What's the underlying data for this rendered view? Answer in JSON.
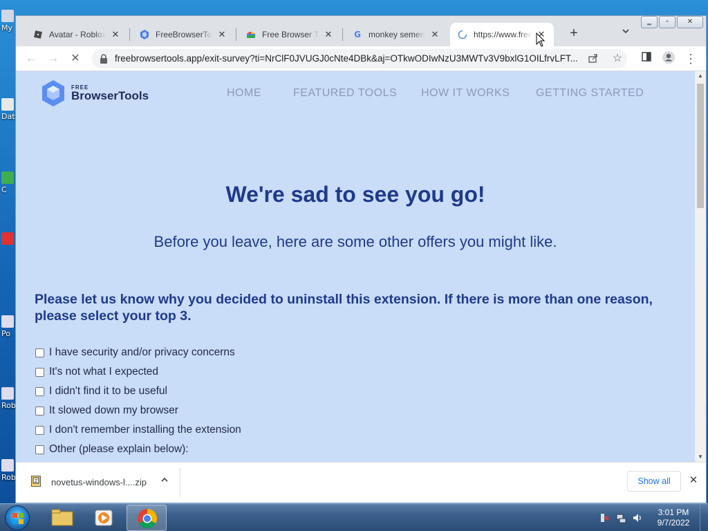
{
  "browser": {
    "tabs": [
      {
        "title": "Avatar - Roblox",
        "favicon": "roblox-icon",
        "active": false
      },
      {
        "title": "FreeBrowserTools",
        "favicon": "freebrowsertools-icon",
        "active": false
      },
      {
        "title": "Free Browser Tools",
        "favicon": "chrome-webstore-icon",
        "active": false
      },
      {
        "title": "monkey semen -",
        "favicon": "google-icon",
        "active": false
      },
      {
        "title": "https://www.free",
        "favicon": "loading-spinner-icon",
        "active": true
      }
    ],
    "new_tab_label": "+",
    "toolbar": {
      "url": "freebrowsertools.app/exit-survey?ti=NrClF0JVUGJ0cNte4DBk&aj=OTkwODIwNzU3MWTv3V9bxlG1OILfrvLFT..."
    }
  },
  "site": {
    "logo_small": "FREE",
    "logo_big": "BrowserTools",
    "nav": [
      "HOME",
      "FEATURED TOOLS",
      "HOW IT WORKS",
      "GETTING STARTED"
    ],
    "headline": "We're sad to see you go!",
    "subline": "Before you leave, here are some other offers you might like.",
    "question": "Please let us know why you decided to uninstall this extension. If there is more than one reason, please select your top 3.",
    "options": [
      "I have security and/or privacy concerns",
      "It's not what I expected",
      "I didn't find it to be useful",
      "It slowed down my browser",
      "I don't remember installing the extension",
      "Other (please explain below):"
    ]
  },
  "download_bar": {
    "filename": "novetus-windows-l....zip",
    "show_all": "Show all"
  },
  "taskbar": {
    "time": "3:01 PM",
    "date": "9/7/2022"
  },
  "desktop": {
    "icon_labels": [
      "My",
      "Dat",
      "C",
      "Po",
      "Rob",
      "Rob"
    ]
  },
  "colors": {
    "page_bg": "#c9dcf8",
    "heading": "#1f3a8a",
    "link_blue": "#1a73e8"
  }
}
